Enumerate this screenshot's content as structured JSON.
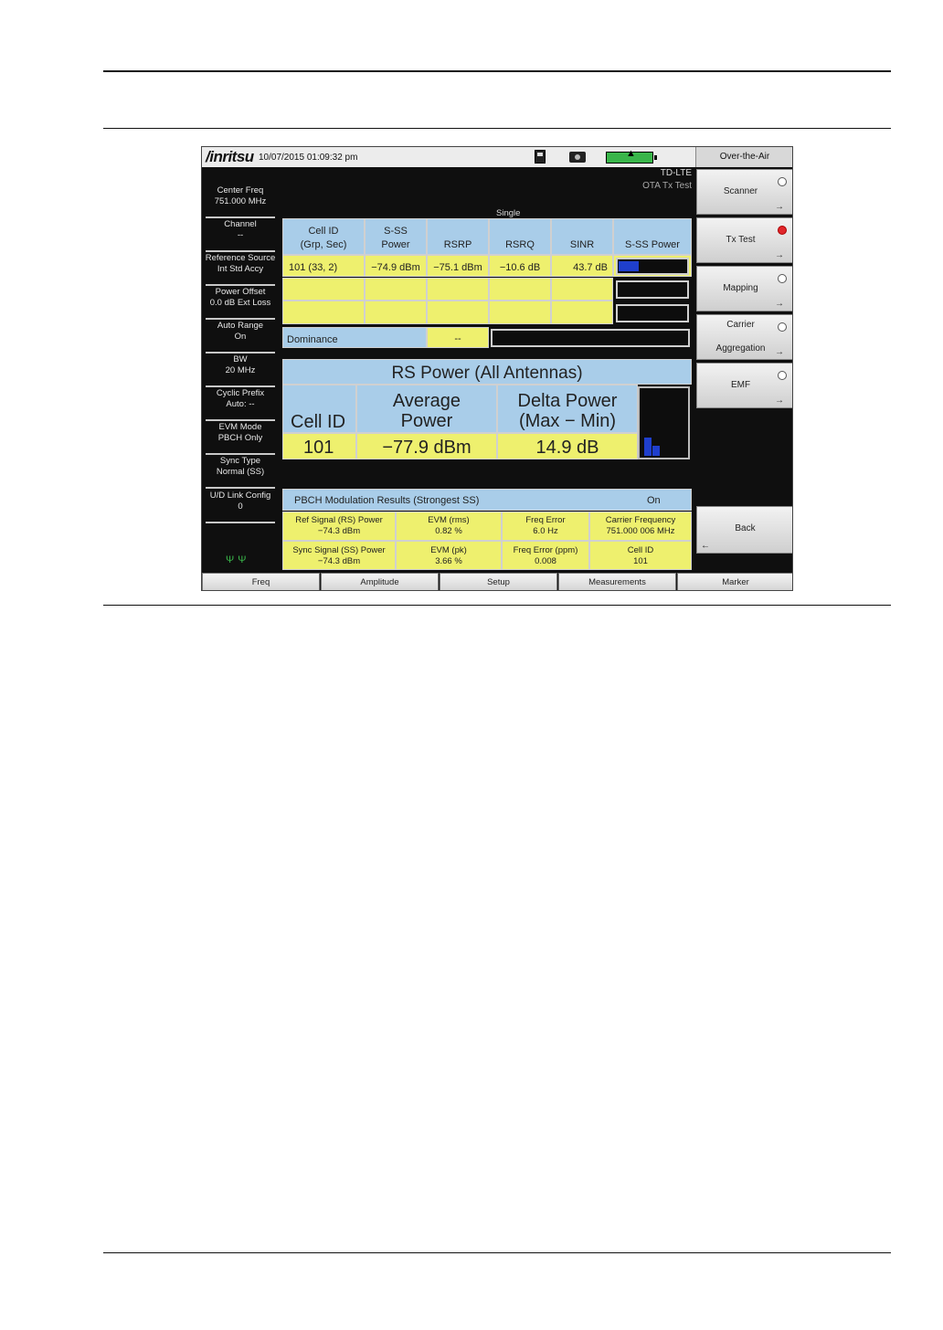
{
  "screen": {
    "logo": "/inritsu",
    "datetime": "10/07/2015 01:09:32 pm",
    "mode_title": "Over-the-Air",
    "technology": "TD-LTE",
    "test_name": "OTA Tx Test",
    "sweep_mode": "Single",
    "battery_icon": "battery-charging-icon",
    "colors": {
      "header_blue": "#a9cde9",
      "value_yellow": "#eef06e",
      "bar_blue": "#1f3fcc",
      "radio_active": "#e0262b"
    }
  },
  "left_panel": [
    {
      "l1": "Center Freq",
      "l2": "751.000 MHz"
    },
    {
      "l1": "Channel",
      "l2": "--"
    },
    {
      "l1": "Reference Source",
      "l2": "Int Std Accy"
    },
    {
      "l1": "Power Offset",
      "l2": "0.0 dB Ext Loss"
    },
    {
      "l1": "Auto Range",
      "l2": "On"
    },
    {
      "l1": "BW",
      "l2": "20 MHz"
    },
    {
      "l1": "Cyclic Prefix",
      "l2": "Auto: --"
    },
    {
      "l1": "EVM Mode",
      "l2": "PBCH Only"
    },
    {
      "l1": "Sync Type",
      "l2": "Normal (SS)"
    },
    {
      "l1": "U/D Link Config",
      "l2": "0"
    }
  ],
  "antenna_icon": "ΨΨ",
  "right_keys": {
    "scanner": "Scanner",
    "tx_test": "Tx Test",
    "mapping": "Mapping",
    "carrier_l1": "Carrier",
    "carrier_l2": "Aggregation",
    "emf": "EMF",
    "back": "Back",
    "active": "tx_test"
  },
  "bottom_keys": [
    "Freq",
    "Amplitude",
    "Setup",
    "Measurements",
    "Marker"
  ],
  "scanner_table": {
    "headers": [
      {
        "l1": "Cell ID",
        "l2": "(Grp, Sec)"
      },
      {
        "l1": "S-SS",
        "l2": "Power"
      },
      {
        "l1": "",
        "l2": "RSRP"
      },
      {
        "l1": "",
        "l2": "RSRQ"
      },
      {
        "l1": "",
        "l2": "SINR"
      },
      {
        "l1": "",
        "l2": "S-SS Power"
      }
    ],
    "row1": [
      "101 (33, 2)",
      "−74.9 dBm",
      "−75.1 dBm",
      "−10.6 dB",
      "43.7 dB"
    ],
    "row1_bar_fraction": 0.3,
    "dominance_label": "Dominance",
    "dominance_value": "--"
  },
  "rs_power": {
    "title": "RS Power (All Antennas)",
    "col1": "Cell ID",
    "col2_l1": "Average",
    "col2_l2": "Power",
    "col3_l1": "Delta Power",
    "col3_l2": "(Max − Min)",
    "cell_id": "101",
    "avg_power": "−77.9 dBm",
    "delta_power": "14.9 dB"
  },
  "pbch": {
    "title": "PBCH Modulation Results (Strongest SS)",
    "status": "On",
    "cells": [
      {
        "l1": "Ref Signal (RS) Power",
        "l2": "−74.3 dBm"
      },
      {
        "l1": "EVM (rms)",
        "l2": "0.82 %"
      },
      {
        "l1": "Freq Error",
        "l2": "6.0 Hz"
      },
      {
        "l1": "Carrier Frequency",
        "l2": "751.000 006 MHz"
      },
      {
        "l1": "Sync Signal (SS) Power",
        "l2": "−74.3 dBm"
      },
      {
        "l1": "EVM (pk)",
        "l2": "3.66 %"
      },
      {
        "l1": "Freq Error (ppm)",
        "l2": "0.008"
      },
      {
        "l1": "Cell ID",
        "l2": "101"
      }
    ]
  }
}
